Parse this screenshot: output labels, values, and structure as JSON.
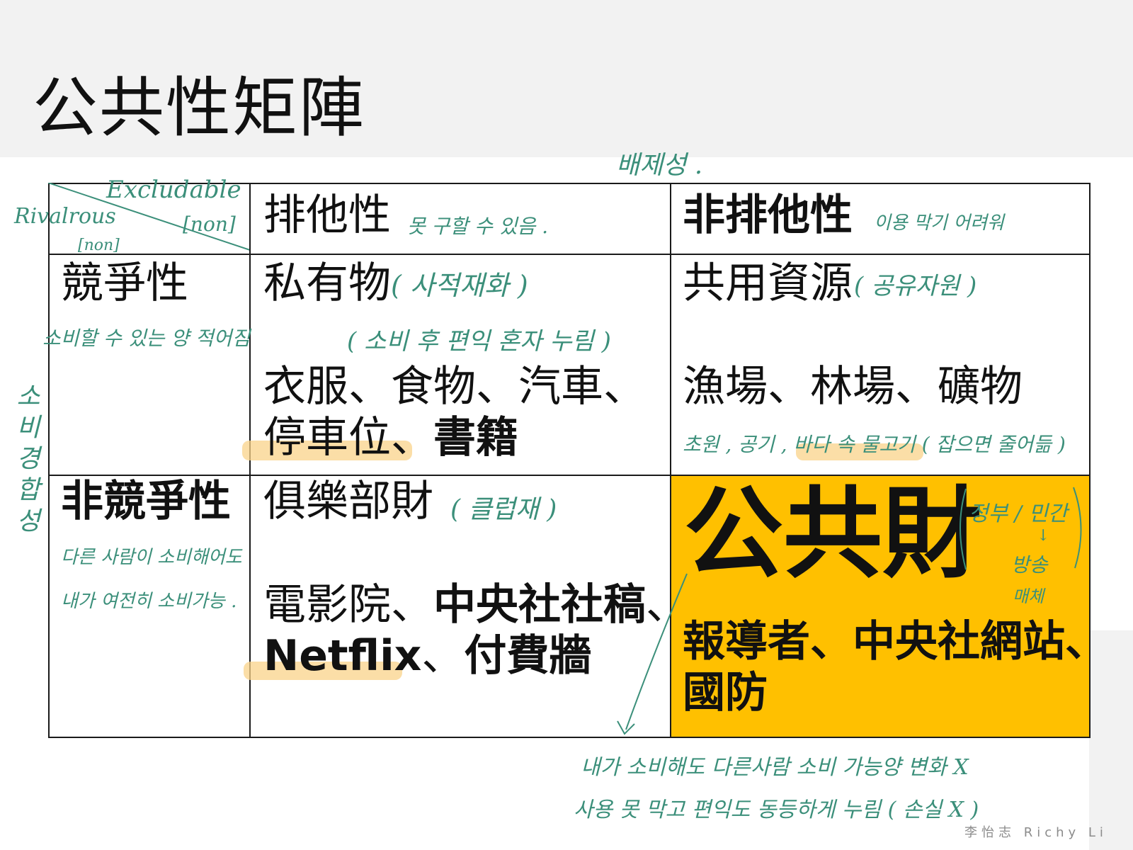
{
  "title": "公共性矩陣",
  "corner": {
    "top_label": "Excludable",
    "top_sub": "[non]",
    "left_label": "Rivalrous",
    "left_sub": "[non]"
  },
  "columns": {
    "excludable": "排他性",
    "non_excludable": "非排他性"
  },
  "rows": {
    "rival": "競爭性",
    "non_rival": "非競爭性"
  },
  "cells": {
    "private": {
      "title": "私有物",
      "examples_line1": "衣服、食物、汽車、",
      "examples_line2_a": "停車位",
      "examples_line2_sep": "、",
      "examples_line2_b": "書籍"
    },
    "common": {
      "title": "共用資源",
      "examples": "漁場、林場、礦物"
    },
    "club": {
      "title": "俱樂部財",
      "examples_line1_a": "電影院、",
      "examples_line1_b": "中央社社稿",
      "examples_line1_c": "、",
      "examples_line2_a": "Netflix",
      "examples_line2_sep": "、",
      "examples_line2_b": "付費牆"
    },
    "public": {
      "title": "公共財",
      "examples_line1": "報導者、中央社網站、",
      "examples_line2": "國防"
    }
  },
  "handwritten_notes": {
    "top_col": "배제성 .",
    "excl_note": "못 구할 수 있음 .",
    "nonexcl_note": "이용 막기 어려워",
    "private_note": "( 사적재화 )",
    "private_note2": "( 소비 후 편익 혼자 누림 )",
    "rival_note": "소비할 수 있는 양 적어짐",
    "common_note": "( 공유자원 )",
    "common_note2": "초원 , 공기 , 바다 속 물고기 ( 잡으면 줄어듦 )",
    "left_vertical": "소비경합성",
    "club_note": "( 클럽재 )",
    "nonrival_note1": "다른 사람이 소비해어도",
    "nonrival_note2": "내가 여전히 소비가능 .",
    "public_note1": "정부 / 민간",
    "public_note2": "↓",
    "public_note3": "방송",
    "public_note4": "매체",
    "bottom_note1": "내가 소비해도 다른사람 소비 가능양 변화 X",
    "bottom_note2": "사용 못 막고 편익도 동등하게 누림 ( 손실 X )"
  },
  "signature": "李怡志 Richy Li",
  "colors": {
    "gold": "#ffc000",
    "handwriting": "#3b8f7a",
    "highlight": "#f9d38a"
  }
}
